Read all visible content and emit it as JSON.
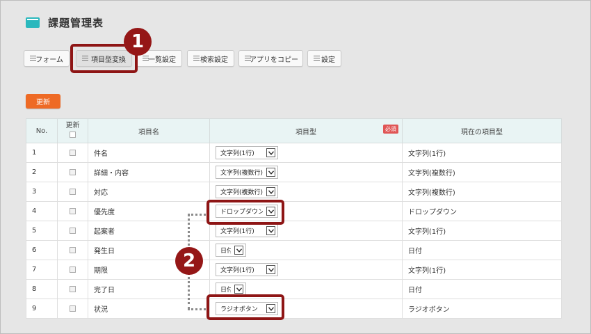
{
  "app": {
    "title": "課題管理表"
  },
  "tabs": [
    {
      "label": "フォーム"
    },
    {
      "label": "項目型変換"
    },
    {
      "label": "一覧設定"
    },
    {
      "label": "検索設定"
    },
    {
      "label": "アプリをコピー"
    },
    {
      "label": "設定"
    }
  ],
  "toolbar": {
    "update_label": "更新"
  },
  "table": {
    "headers": {
      "no": "No.",
      "update": "更新",
      "name": "項目名",
      "type": "項目型",
      "required": "必須",
      "current": "現在の項目型"
    },
    "rows": [
      {
        "no": "1",
        "name": "件名",
        "type": "文字列(1行)",
        "current": "文字列(1行)"
      },
      {
        "no": "2",
        "name": "詳細・内容",
        "type": "文字列(複数行)",
        "current": "文字列(複数行)"
      },
      {
        "no": "3",
        "name": "対応",
        "type": "文字列(複数行)",
        "current": "文字列(複数行)"
      },
      {
        "no": "4",
        "name": "優先度",
        "type": "ドロップダウン",
        "current": "ドロップダウン"
      },
      {
        "no": "5",
        "name": "起案者",
        "type": "文字列(1行)",
        "current": "文字列(1行)"
      },
      {
        "no": "6",
        "name": "発生日",
        "type": "日付",
        "current": "日付"
      },
      {
        "no": "7",
        "name": "期限",
        "type": "文字列(1行)",
        "current": "文字列(1行)"
      },
      {
        "no": "8",
        "name": "完了日",
        "type": "日付",
        "current": "日付"
      },
      {
        "no": "9",
        "name": "状況",
        "type": "ラジオボタン",
        "current": "ラジオボタン"
      }
    ]
  },
  "annotations": {
    "badge1": "1",
    "badge2": "2"
  },
  "colors": {
    "accent_orange": "#ee6a25",
    "annotation_red": "#951717",
    "header_teal": "#e9f4f4",
    "app_icon": "#2ab8bd"
  }
}
